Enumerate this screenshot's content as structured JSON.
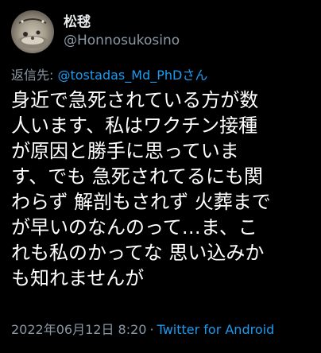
{
  "author": {
    "display_name": "松毬",
    "handle": "@Honnosukosino"
  },
  "reply": {
    "prefix": "返信先: ",
    "target": "@tostadas_Md_PhDさん"
  },
  "body": {
    "lines": [
      "身近で急死されている方が数",
      "人います、私はワクチン接種",
      "が原因と勝手に思っていま",
      "す、でも 急死されてるにも関",
      "わらず 解剖もされず 火葬まで",
      "が早いのなんのって…ま、こ",
      "れも私のかってな 思い込みか",
      "も知れませんが"
    ]
  },
  "meta": {
    "timestamp": "2022年06月12日 8:20",
    "separator": "·",
    "client": "Twitter for Android"
  },
  "colors": {
    "background": "#000000",
    "text": "#ffffff",
    "secondary": "#8b98a5",
    "link": "#1d9bf0"
  }
}
